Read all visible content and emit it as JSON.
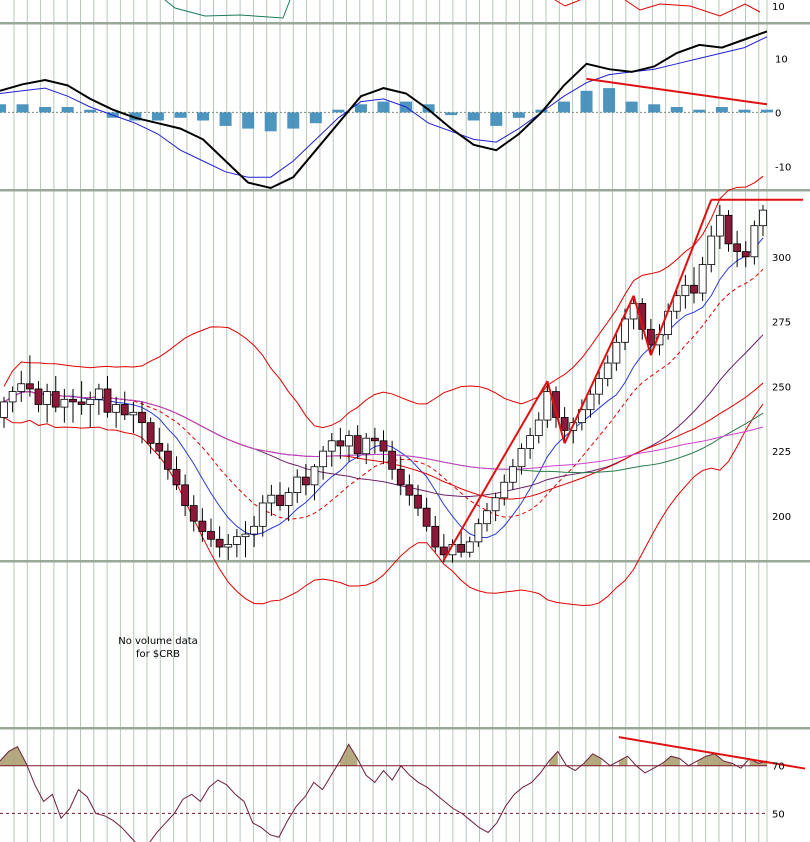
{
  "colors": {
    "background": "#ffffff",
    "grid": "#b8c8b8",
    "separator": "#9aa89a",
    "up_candle": "#ffffff",
    "down_candle": "#8b1a3a",
    "trendline": "#e01010",
    "macd_line": "#000000",
    "macd_signal": "#2020d0",
    "macd_histogram": "#3a8ab8",
    "envelope": "#e00000",
    "sma_short": "#2a3adf",
    "sma_purple": "#6a1f6a",
    "sma_green": "#2a7a4a",
    "sma_magenta": "#d040d0",
    "rsi_line": "#6a1f3a",
    "rsi_fill": "#a89a6a"
  },
  "chart_data": [
    {
      "panel": "top-indicator",
      "type": "line",
      "ticks": [
        "10"
      ]
    },
    {
      "panel": "macd",
      "type": "line",
      "ylim": [
        -14,
        16
      ],
      "ticks": [
        "10",
        "0",
        "-10"
      ],
      "macd": [
        4,
        5.2,
        6,
        5,
        2.5,
        0.5,
        -1,
        -2,
        -3,
        -5,
        -9,
        -13,
        -14,
        -12,
        -7,
        -2,
        3,
        4.5,
        3.5,
        0.5,
        -3,
        -6,
        -7,
        -4,
        0,
        5,
        9,
        8,
        7.5,
        8.5,
        11,
        12.5,
        12,
        13.5,
        15
      ],
      "signal": [
        3.5,
        4,
        4.5,
        3,
        1,
        -0.5,
        -2,
        -4,
        -7,
        -9,
        -11,
        -12,
        -12,
        -9,
        -5,
        -1,
        2,
        2.5,
        1,
        -2,
        -3.5,
        -5,
        -5.5,
        -3,
        0,
        3,
        5.5,
        7,
        7.5,
        8,
        9,
        10,
        11,
        12,
        14
      ],
      "histogram": [
        1.5,
        1.5,
        1,
        1,
        0.5,
        -1,
        -1.5,
        -1.5,
        -1,
        -1.5,
        -2.5,
        -3,
        -3.5,
        -3,
        -2,
        0.5,
        1.5,
        2,
        2,
        1.5,
        -0.5,
        -1.5,
        -2.5,
        -1,
        0.5,
        2,
        4,
        4.5,
        2,
        1.5,
        1,
        0.5,
        1,
        0.5,
        0.5
      ],
      "trendline": {
        "from": [
          26,
          6.2
        ],
        "to": [
          34,
          1.5
        ]
      }
    },
    {
      "panel": "price",
      "type": "candlestick",
      "ylim": [
        183,
        325
      ],
      "ticks": [
        "300",
        "275",
        "250",
        "225",
        "200"
      ],
      "candles": [
        [
          238,
          246,
          234,
          244
        ],
        [
          244,
          250,
          240,
          248
        ],
        [
          248,
          256,
          244,
          251
        ],
        [
          251,
          262,
          246,
          249
        ],
        [
          249,
          252,
          240,
          243
        ],
        [
          243,
          251,
          236,
          248
        ],
        [
          248,
          254,
          240,
          242
        ],
        [
          242,
          249,
          236,
          245
        ],
        [
          245,
          249,
          236,
          244
        ],
        [
          244,
          252,
          239,
          243
        ],
        [
          243,
          248,
          234,
          245
        ],
        [
          245,
          251,
          239,
          249
        ],
        [
          249,
          254,
          238,
          240
        ],
        [
          240,
          246,
          234,
          243
        ],
        [
          243,
          248,
          237,
          239
        ],
        [
          239,
          244,
          232,
          240
        ],
        [
          240,
          244,
          228,
          236
        ],
        [
          236,
          238,
          224,
          228
        ],
        [
          228,
          234,
          222,
          225
        ],
        [
          225,
          228,
          214,
          218
        ],
        [
          218,
          223,
          210,
          212
        ],
        [
          212,
          216,
          200,
          204
        ],
        [
          204,
          208,
          194,
          198
        ],
        [
          198,
          203,
          190,
          194
        ],
        [
          194,
          199,
          188,
          191
        ],
        [
          191,
          196,
          184,
          188
        ],
        [
          188,
          193,
          183,
          189
        ],
        [
          189,
          195,
          184,
          192
        ],
        [
          192,
          198,
          184,
          193
        ],
        [
          193,
          200,
          188,
          196
        ],
        [
          196,
          208,
          192,
          205
        ],
        [
          205,
          212,
          200,
          208
        ],
        [
          208,
          213,
          202,
          204
        ],
        [
          204,
          211,
          198,
          209
        ],
        [
          209,
          218,
          205,
          215
        ],
        [
          215,
          220,
          208,
          212
        ],
        [
          212,
          220,
          206,
          219
        ],
        [
          219,
          227,
          214,
          225
        ],
        [
          225,
          232,
          219,
          229
        ],
        [
          229,
          234,
          222,
          227
        ],
        [
          227,
          233,
          221,
          231
        ],
        [
          231,
          235,
          222,
          224
        ],
        [
          224,
          232,
          220,
          230
        ],
        [
          230,
          234,
          224,
          229
        ],
        [
          229,
          233,
          220,
          225
        ],
        [
          225,
          229,
          214,
          218
        ],
        [
          218,
          223,
          208,
          212
        ],
        [
          212,
          216,
          204,
          208
        ],
        [
          208,
          212,
          200,
          203
        ],
        [
          203,
          207,
          194,
          196
        ],
        [
          196,
          200,
          186,
          188
        ],
        [
          188,
          193,
          182,
          185
        ],
        [
          185,
          191,
          182,
          189
        ],
        [
          189,
          194,
          184,
          186
        ],
        [
          186,
          192,
          184,
          190
        ],
        [
          190,
          199,
          188,
          197
        ],
        [
          197,
          205,
          194,
          202
        ],
        [
          202,
          209,
          198,
          207
        ],
        [
          207,
          216,
          204,
          213
        ],
        [
          213,
          222,
          210,
          219
        ],
        [
          219,
          228,
          216,
          226
        ],
        [
          226,
          234,
          222,
          231
        ],
        [
          231,
          240,
          228,
          237
        ],
        [
          237,
          252,
          234,
          248
        ],
        [
          248,
          250,
          234,
          238
        ],
        [
          238,
          242,
          228,
          233
        ],
        [
          233,
          238,
          228,
          236
        ],
        [
          236,
          245,
          233,
          241
        ],
        [
          241,
          250,
          238,
          247
        ],
        [
          247,
          256,
          243,
          253
        ],
        [
          253,
          262,
          250,
          259
        ],
        [
          259,
          270,
          256,
          267
        ],
        [
          267,
          280,
          264,
          276
        ],
        [
          276,
          285,
          272,
          282
        ],
        [
          282,
          284,
          268,
          272
        ],
        [
          272,
          276,
          262,
          266
        ],
        [
          266,
          274,
          262,
          270
        ],
        [
          270,
          282,
          268,
          279
        ],
        [
          279,
          288,
          276,
          285
        ],
        [
          285,
          293,
          280,
          289
        ],
        [
          289,
          296,
          282,
          286
        ],
        [
          286,
          300,
          283,
          297
        ],
        [
          297,
          312,
          294,
          308
        ],
        [
          308,
          320,
          303,
          316
        ],
        [
          316,
          318,
          302,
          305
        ],
        [
          305,
          310,
          296,
          302
        ],
        [
          302,
          306,
          296,
          300
        ],
        [
          300,
          314,
          297,
          312
        ],
        [
          312,
          320,
          308,
          318
        ]
      ],
      "trendlines": [
        {
          "from": [
            51,
            183
          ],
          "to": [
            63,
            252
          ]
        },
        {
          "from": [
            63,
            252
          ],
          "to": [
            65,
            228
          ]
        },
        {
          "from": [
            65,
            228
          ],
          "to": [
            73,
            285
          ]
        },
        {
          "from": [
            73,
            285
          ],
          "to": [
            75,
            262
          ]
        },
        {
          "from": [
            75,
            262
          ],
          "to": [
            82,
            322
          ]
        },
        {
          "from": [
            82,
            322
          ],
          "to": [
            88,
            322
          ]
        }
      ]
    },
    {
      "panel": "volume",
      "type": "text",
      "message_line1": "No volume data",
      "message_line2": "for $CRB"
    },
    {
      "panel": "rsi",
      "type": "line",
      "ylim": [
        38,
        85
      ],
      "ticks": [
        "70",
        "50"
      ],
      "levels": [
        70,
        50
      ],
      "values": [
        72,
        76,
        78,
        71,
        62,
        55,
        58,
        48,
        52,
        60,
        57,
        50,
        49,
        47,
        44,
        40,
        36,
        37,
        42,
        46,
        50,
        56,
        58,
        55,
        61,
        64,
        62,
        58,
        55,
        46,
        44,
        41,
        40,
        47,
        53,
        57,
        63,
        60,
        66,
        72,
        79,
        73,
        66,
        63,
        68,
        64,
        70,
        66,
        63,
        61,
        58,
        55,
        52,
        50,
        47,
        44,
        42,
        46,
        53,
        58,
        61,
        63,
        67,
        72,
        76,
        70,
        68,
        71,
        75,
        73,
        70,
        72,
        74,
        70,
        67,
        69,
        71,
        74,
        73,
        70,
        72,
        74,
        75,
        72,
        71,
        69,
        73,
        71,
        72
      ],
      "trendline": {
        "from": [
          71,
          82
        ],
        "to": [
          88,
          70.5
        ]
      }
    }
  ]
}
